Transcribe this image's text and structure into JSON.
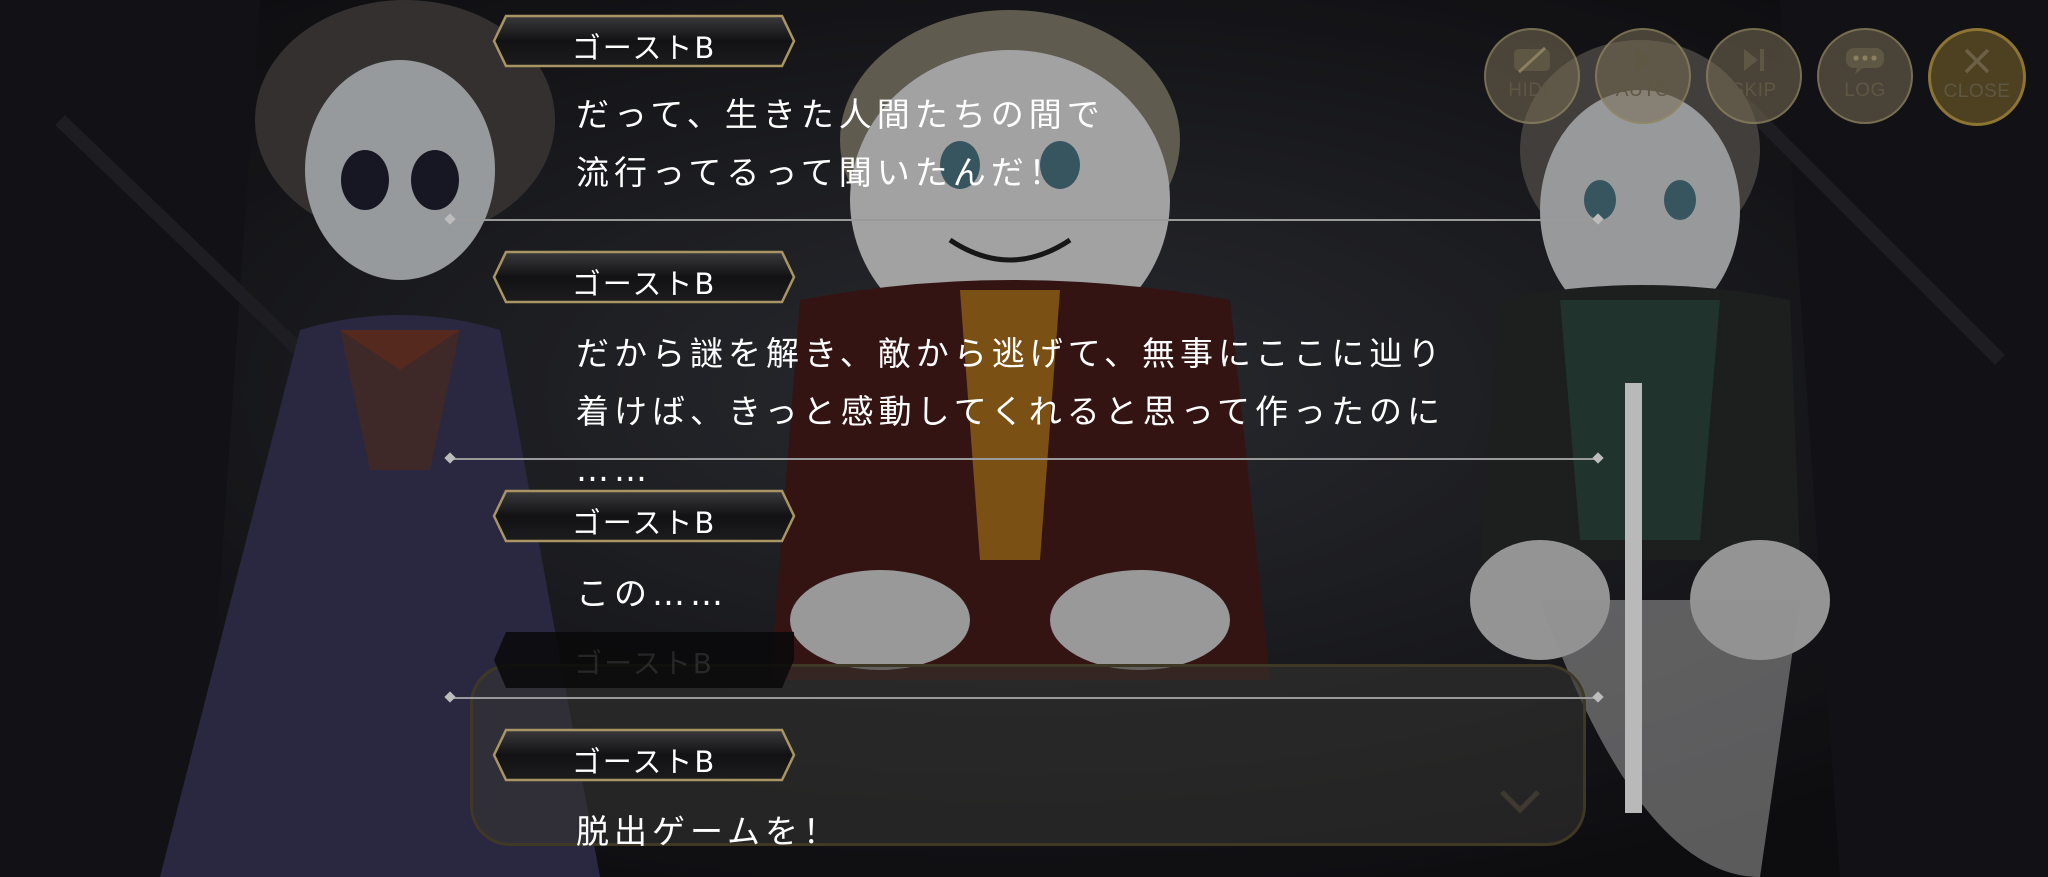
{
  "controls": {
    "hide": "HIDE",
    "auto": "AUTO",
    "skip": "SKIP",
    "log": "LOG",
    "close": "CLOSE"
  },
  "underlying_dialogue": {
    "speaker": "ゴーストB",
    "text": "を！"
  },
  "log": {
    "entries": [
      {
        "speaker": "ゴーストB",
        "text": "だって、生きた人間たちの間で\n流行ってるって聞いたんだ！"
      },
      {
        "speaker": "ゴーストB",
        "text": "だから謎を解き、敵から逃げて、無事にここに辿り\n着けば、きっと感動してくれると思って作ったのに\n……"
      },
      {
        "speaker": "ゴーストB",
        "text": "この……"
      },
      {
        "speaker": "ゴーストB",
        "text": "脱出ゲームを！"
      }
    ]
  }
}
